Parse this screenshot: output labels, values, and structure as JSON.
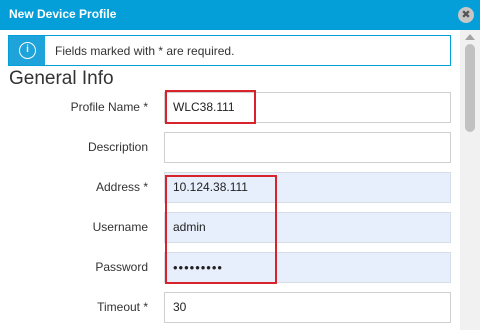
{
  "dialog": {
    "title": "New Device Profile",
    "close_glyph": "✖",
    "close_icon": "close-icon"
  },
  "banner": {
    "icon": "info-icon",
    "icon_glyph": "i",
    "message": "Fields marked with * are required."
  },
  "section": {
    "title": "General Info"
  },
  "fields": {
    "profile_name": {
      "label": "Profile Name *",
      "value": "WLC38.111"
    },
    "description": {
      "label": "Description",
      "value": ""
    },
    "address": {
      "label": "Address *",
      "value": "10.124.38.111"
    },
    "username": {
      "label": "Username",
      "value": "admin"
    },
    "password": {
      "label": "Password",
      "value": "•••••••••"
    },
    "timeout": {
      "label": "Timeout *",
      "value": "30"
    }
  },
  "colors": {
    "titlebar": "#049fd9",
    "highlight": "#d8232a",
    "filled_input": "#e8effc"
  }
}
